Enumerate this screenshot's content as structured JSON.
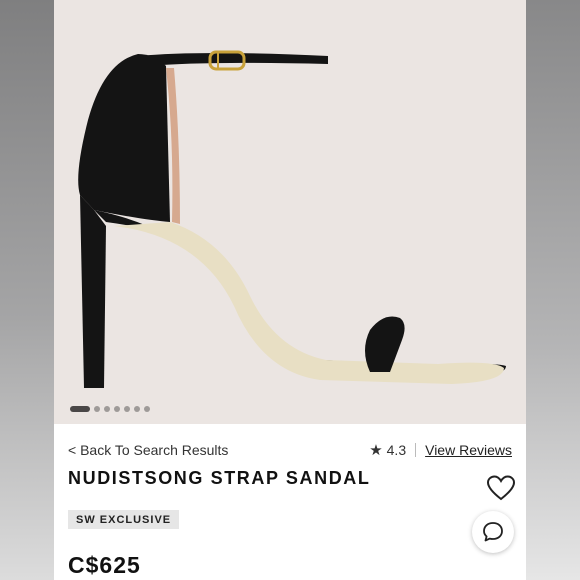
{
  "product": {
    "back_link": "< Back To Search Results",
    "rating": "4.3",
    "reviews_link": "View Reviews",
    "title": "NUDISTSONG STRAP SANDAL",
    "badge": "SW EXCLUSIVE",
    "price": "C$625"
  },
  "gallery": {
    "image_count": 7,
    "active_index": 0
  },
  "icons": {
    "star": "star-icon",
    "wishlist": "heart-icon",
    "chat": "chat-bubble-icon"
  },
  "colors": {
    "hero_background": "#ebe5e2",
    "sandal": "#141414",
    "buckle": "#c9a23a"
  }
}
